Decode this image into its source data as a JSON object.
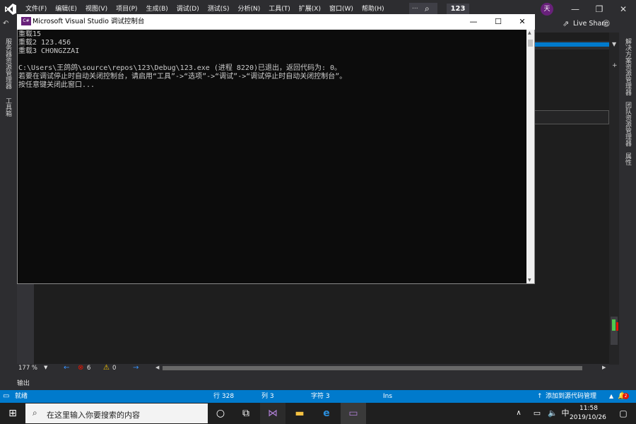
{
  "menubar": {
    "items": [
      "文件(F)",
      "编辑(E)",
      "视图(V)",
      "项目(P)",
      "生成(B)",
      "调试(D)",
      "测试(S)",
      "分析(N)",
      "工具(T)",
      "扩展(X)",
      "窗口(W)",
      "帮助(H)"
    ],
    "search_text": "...",
    "solution_name": "123",
    "avatar_text": "天",
    "live_share": "Live Share"
  },
  "left_strip": {
    "tabs": [
      "服务器资源管理器",
      "工具箱"
    ]
  },
  "right_strip": {
    "tabs": [
      "解决方案资源管理器",
      "团队资源管理器",
      "属性"
    ]
  },
  "console": {
    "title": "Microsoft Visual Studio 调试控制台",
    "app_icon_text": "C#",
    "lines": [
      "重载15",
      "重载2 123.456",
      "重载3 CHONGZZAI",
      "",
      "C:\\Users\\王鸽鸽\\source\\repos\\123\\Debug\\123.exe (进程 8220)已退出，返回代码为: 0。",
      "若要在调试停止时自动关闭控制台，请启用“工具”->“选项”->“调试”->“调试停止时自动关闭控制台”。",
      "按任意键关闭此窗口..."
    ]
  },
  "editor_status": {
    "zoom": "177 %",
    "errors": "6",
    "warnings": "0"
  },
  "output_bar": {
    "label": "输出"
  },
  "statusbar": {
    "ready": "就绪",
    "line": "行 328",
    "col": "列 3",
    "char": "字符 3",
    "ins": "Ins",
    "source_control": "添加到源代码管理",
    "notifications": "2"
  },
  "taskbar": {
    "search_placeholder": "在这里输入你要搜索的内容",
    "ime": "中",
    "time": "11:58",
    "date": "2019/10/26"
  },
  "colors": {
    "accent": "#007acc",
    "vs_purple": "#68217a",
    "console_bg": "#0c0c0c"
  }
}
